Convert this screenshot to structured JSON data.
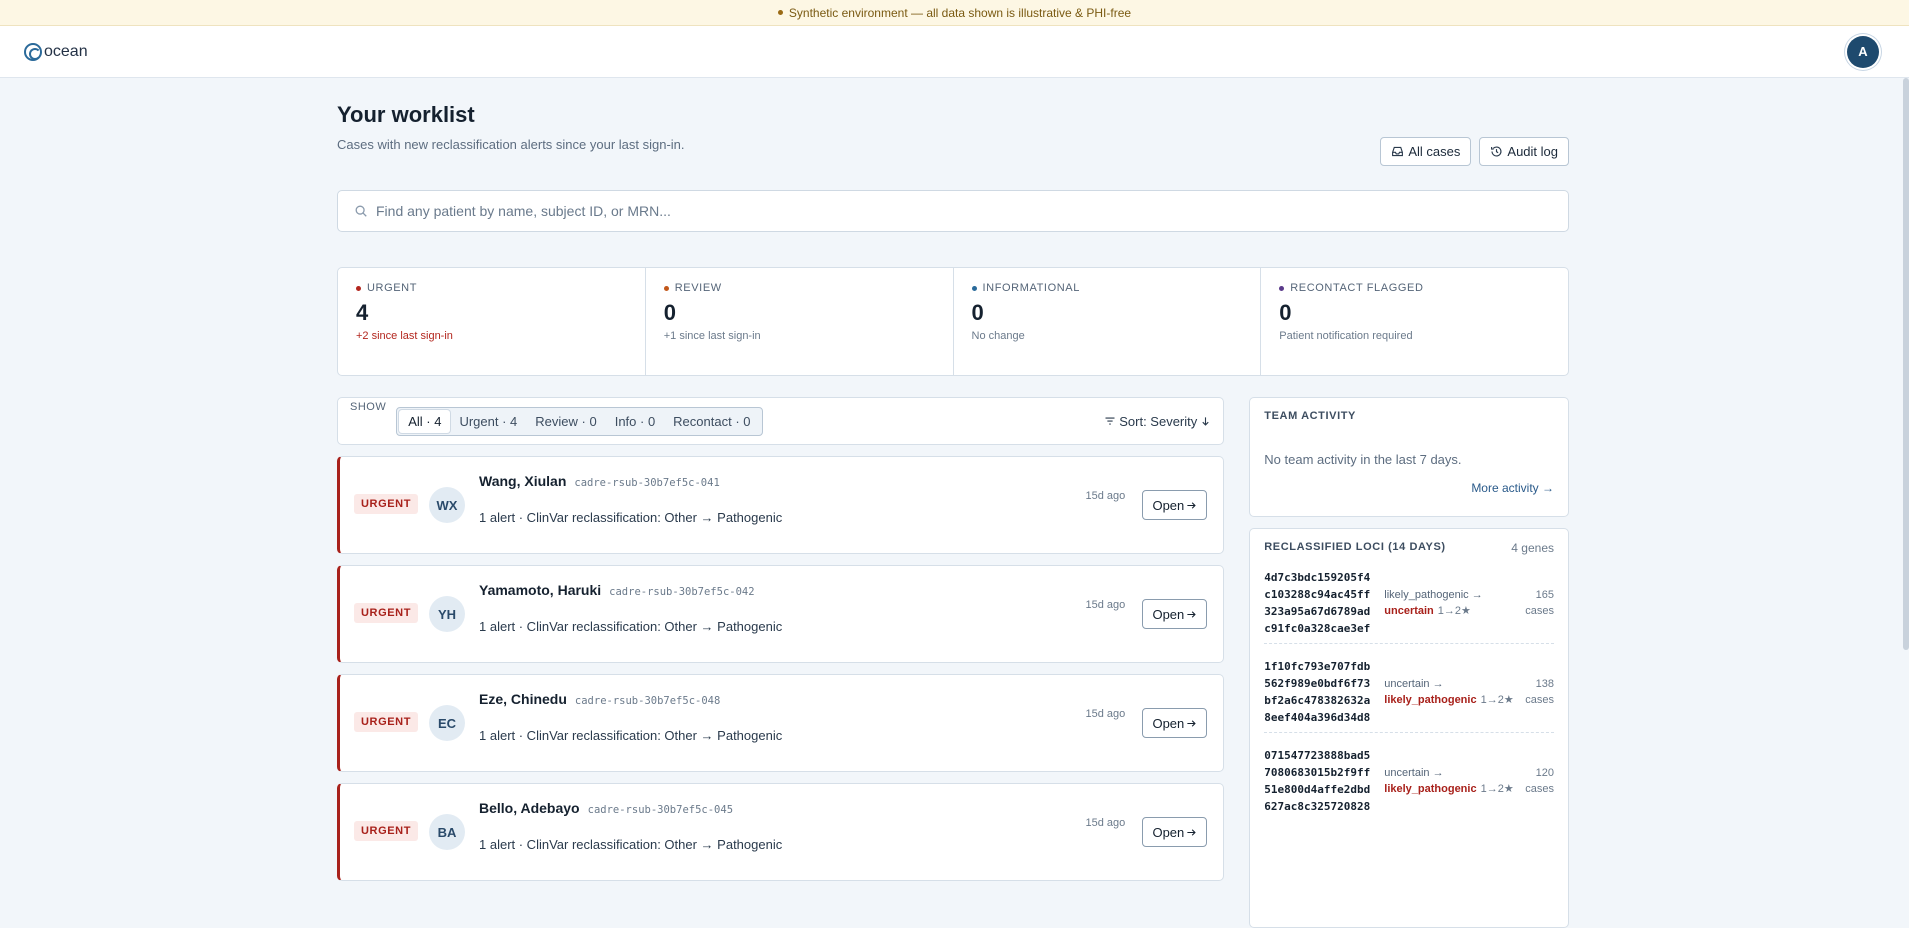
{
  "banner": {
    "text": "Synthetic environment — all data shown is illustrative & PHI-free"
  },
  "brand": {
    "name": "ocean"
  },
  "user": {
    "initial": "A"
  },
  "page": {
    "title": "Your worklist",
    "subtitle": "Cases with new reclassification alerts since your last sign-in."
  },
  "actions": {
    "all_cases": "All cases",
    "audit_log": "Audit log"
  },
  "search": {
    "placeholder": "Find any patient by name, subject ID, or MRN..."
  },
  "stats": [
    {
      "label": "URGENT",
      "value": "4",
      "note": "+2 since last sign-in",
      "color": "#b3261e"
    },
    {
      "label": "REVIEW",
      "value": "0",
      "note": "+1 since last sign-in",
      "color": "#c2571a"
    },
    {
      "label": "INFORMATIONAL",
      "value": "0",
      "note": "No change",
      "color": "#2a6a9a"
    },
    {
      "label": "RECONTACT FLAGGED",
      "value": "0",
      "note": "Patient notification required",
      "color": "#5a3a8a"
    }
  ],
  "filters": {
    "show_label": "SHOW",
    "options": [
      "All · 4",
      "Urgent · 4",
      "Review · 0",
      "Info · 0",
      "Recontact · 0"
    ],
    "active": "All · 4",
    "sort": "Sort: Severity"
  },
  "cases": [
    {
      "badge": "URGENT",
      "initials": "WX",
      "name": "Wang, Xiulan",
      "subject_id": "cadre-rsub-30b7ef5c-041",
      "alert": "1 alert · ClinVar reclassification: Other → Pathogenic",
      "ago": "15d ago",
      "open": "Open"
    },
    {
      "badge": "URGENT",
      "initials": "YH",
      "name": "Yamamoto, Haruki",
      "subject_id": "cadre-rsub-30b7ef5c-042",
      "alert": "1 alert · ClinVar reclassification: Other → Pathogenic",
      "ago": "15d ago",
      "open": "Open"
    },
    {
      "badge": "URGENT",
      "initials": "EC",
      "name": "Eze, Chinedu",
      "subject_id": "cadre-rsub-30b7ef5c-048",
      "alert": "1 alert · ClinVar reclassification: Other → Pathogenic",
      "ago": "15d ago",
      "open": "Open"
    },
    {
      "badge": "URGENT",
      "initials": "BA",
      "name": "Bello, Adebayo",
      "subject_id": "cadre-rsub-30b7ef5c-045",
      "alert": "1 alert · ClinVar reclassification: Other → Pathogenic",
      "ago": "15d ago",
      "open": "Open"
    }
  ],
  "team": {
    "title": "TEAM ACTIVITY",
    "empty": "No team activity in the last 7 days.",
    "more": "More activity →"
  },
  "loci": {
    "title": "RECLASSIFIED LOCI (14 DAYS)",
    "count": "4 genes",
    "items": [
      {
        "id": "4d7c3bdc159205f4c103288c94ac45ff323a95a67d6789adc91fc0a328cae3ef",
        "from": "likely_pathogenic →",
        "to": "uncertain",
        "stars": "1→2★",
        "cases_num": "165",
        "cases_word": "cases"
      },
      {
        "id": "1f10fc793e707fdb562f989e0bdf6f73bf2a6c478382632a8eef404a396d34d8",
        "from": "uncertain →",
        "to": "likely_pathogenic",
        "stars": "1→2★",
        "cases_num": "138",
        "cases_word": "cases"
      },
      {
        "id": "071547723888bad57080683015b2f9ff51e800d4affe2dbd627ac8c325720828",
        "from": "uncertain →",
        "to": "likely_pathogenic",
        "stars": "1→2★",
        "cases_num": "120",
        "cases_word": "cases"
      }
    ]
  }
}
